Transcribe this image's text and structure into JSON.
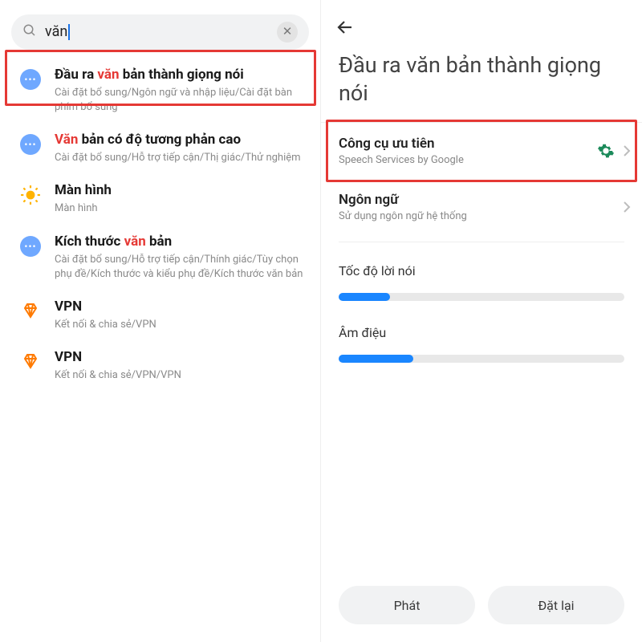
{
  "left": {
    "search_value": "văn",
    "highlight_token": "văn",
    "results": [
      {
        "icon": "dots",
        "title_pre": "Đầu ra ",
        "title_hl": "văn",
        "title_post": " bản thành giọng nói",
        "path": "Cài đặt bổ sung/Ngôn ngữ và nhập liệu/Cài đặt bàn phím bổ sung"
      },
      {
        "icon": "dots",
        "title_pre": "",
        "title_hl": "Văn",
        "title_post": " bản có độ tương phản cao",
        "path": "Cài đặt bổ sung/Hỗ trợ tiếp cận/Thị giác/Thử nghiệm"
      },
      {
        "icon": "sun",
        "title_pre": "Màn hình",
        "title_hl": "",
        "title_post": "",
        "path": "Màn hình"
      },
      {
        "icon": "dots",
        "title_pre": "Kích thước ",
        "title_hl": "văn",
        "title_post": " bản",
        "path": "Cài đặt bổ sung/Hỗ trợ tiếp cận/Thính giác/Tùy chọn phụ đề/Kích thước và kiểu phụ đề/Kích thước văn bản"
      },
      {
        "icon": "vpn",
        "title_pre": "VPN",
        "title_hl": "",
        "title_post": "",
        "path": "Kết nối & chia sẻ/VPN"
      },
      {
        "icon": "vpn",
        "title_pre": "VPN",
        "title_hl": "",
        "title_post": "",
        "path": "Kết nối & chia sẻ/VPN/VPN"
      }
    ]
  },
  "right": {
    "page_title": "Đầu ra văn bản thành giọng nói",
    "engine": {
      "title": "Công cụ ưu tiên",
      "subtitle": "Speech Services by Google"
    },
    "language": {
      "title": "Ngôn ngữ",
      "subtitle": "Sử dụng ngôn ngữ hệ thống"
    },
    "rate_label": "Tốc độ lời nói",
    "rate_percent": 18,
    "pitch_label": "Âm điệu",
    "pitch_percent": 26,
    "play_label": "Phát",
    "reset_label": "Đặt lại"
  }
}
